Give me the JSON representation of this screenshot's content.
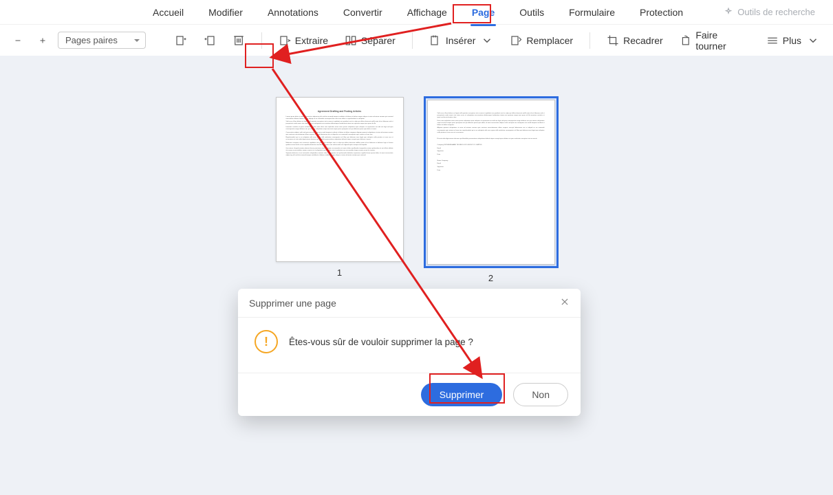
{
  "menu": {
    "items": [
      "Accueil",
      "Modifier",
      "Annotations",
      "Convertir",
      "Affichage",
      "Page",
      "Outils",
      "Formulaire",
      "Protection"
    ],
    "active": "Page",
    "research": "Outils de recherche"
  },
  "toolbar": {
    "select_label": "Pages paires",
    "extract": "Extraire",
    "split": "Séparer",
    "insert": "Insérer",
    "replace": "Remplacer",
    "crop": "Recadrer",
    "rotate": "Faire tourner",
    "more": "Plus"
  },
  "pages": {
    "p1_num": "1",
    "p2_num": "2"
  },
  "dialog": {
    "title": "Supprimer une page",
    "message": "Êtes-vous sûr de vouloir supprimer la page ?",
    "confirm": "Supprimer",
    "cancel": "Non"
  }
}
